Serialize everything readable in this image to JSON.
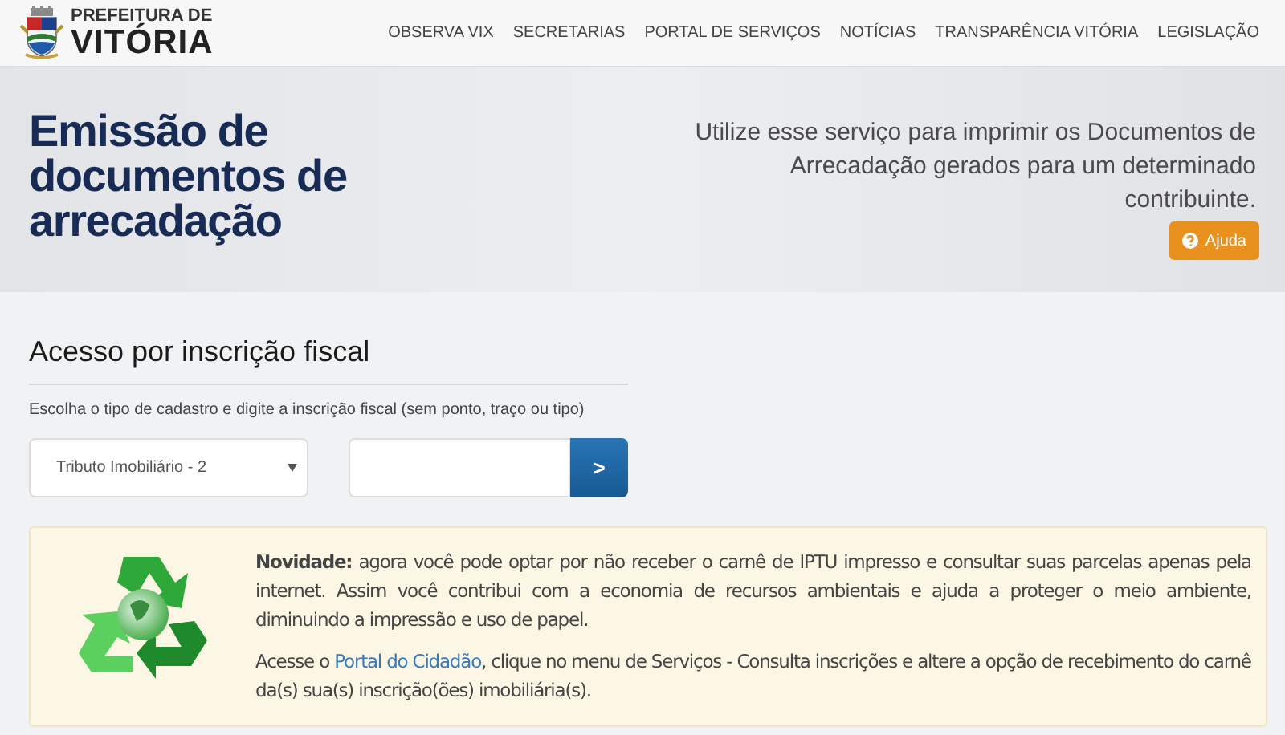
{
  "header": {
    "logo_line1": "PREFEITURA DE",
    "logo_line2": "VITÓRIA",
    "nav": [
      "OBSERVA VIX",
      "SECRETARIAS",
      "PORTAL DE SERVIÇOS",
      "NOTÍCIAS",
      "TRANSPARÊNCIA VITÓRIA",
      "LEGISLAÇÃO"
    ]
  },
  "hero": {
    "title": "Emissão de documentos de arrecadação",
    "description": "Utilize esse serviço para imprimir os Documentos de Arrecadação gerados para um determinado contribuinte.",
    "help_button": "Ajuda"
  },
  "access": {
    "heading": "Acesso por inscrição fiscal",
    "instructions": "Escolha o tipo de cadastro e digite a inscrição fiscal (sem ponto, traço ou tipo)",
    "select_value": "Tributo Imobiliário - 2",
    "submit_button": ">"
  },
  "notice": {
    "paragraph_1": "**Novidade:** agora você pode optar por não receber o carnê de IPTU impresso e consultar suas parcelas apenas pela internet. Assim você contribui com a economia de recursos ambientais e ajuda a proteger o meio ambiente, diminuindo a impressão e uso de papel.",
    "paragraph_2_before": "Acesse o",
    "paragraph_2_link": "Portal do Cidadão",
    "paragraph_2_after": ", clique no menu de Serviços - Consulta inscrições e altere a opção de recebimento do carnê da(s) sua(s) inscrição(ões) imobiliária(s)."
  }
}
